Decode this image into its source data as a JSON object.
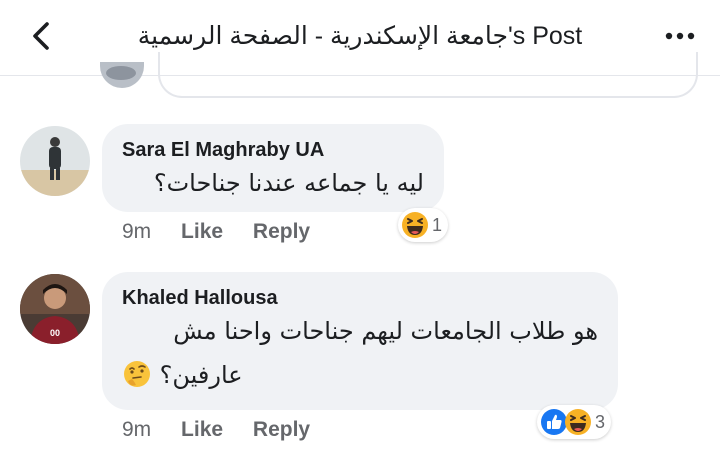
{
  "header": {
    "title": "جامعة الإسكندرية - الصفحة الرسمية's Post",
    "back_icon": "chevron-left-icon",
    "more_icon": "ellipsis-icon"
  },
  "comments": [
    {
      "author": "Sara El Maghraby UA",
      "text": "ليه يا جماعه عندنا جناحات؟",
      "time": "9m",
      "like_label": "Like",
      "reply_label": "Reply",
      "reaction_icons": [
        "haha-icon"
      ],
      "reaction_count": "1"
    },
    {
      "author": "Khaled Hallousa",
      "text_line1": "هو طلاب الجامعات ليهم جناحات واحنا مش",
      "text_line2": "عارفين؟",
      "emoji": "thinking-face-icon",
      "time": "9m",
      "like_label": "Like",
      "reply_label": "Reply",
      "reaction_icons": [
        "like-icon",
        "haha-icon"
      ],
      "reaction_count": "3"
    }
  ],
  "colors": {
    "bubble": "#f0f2f5",
    "meta_text": "#65676b",
    "like_blue": "#1877f2",
    "haha_yellow": "#f7b125"
  }
}
